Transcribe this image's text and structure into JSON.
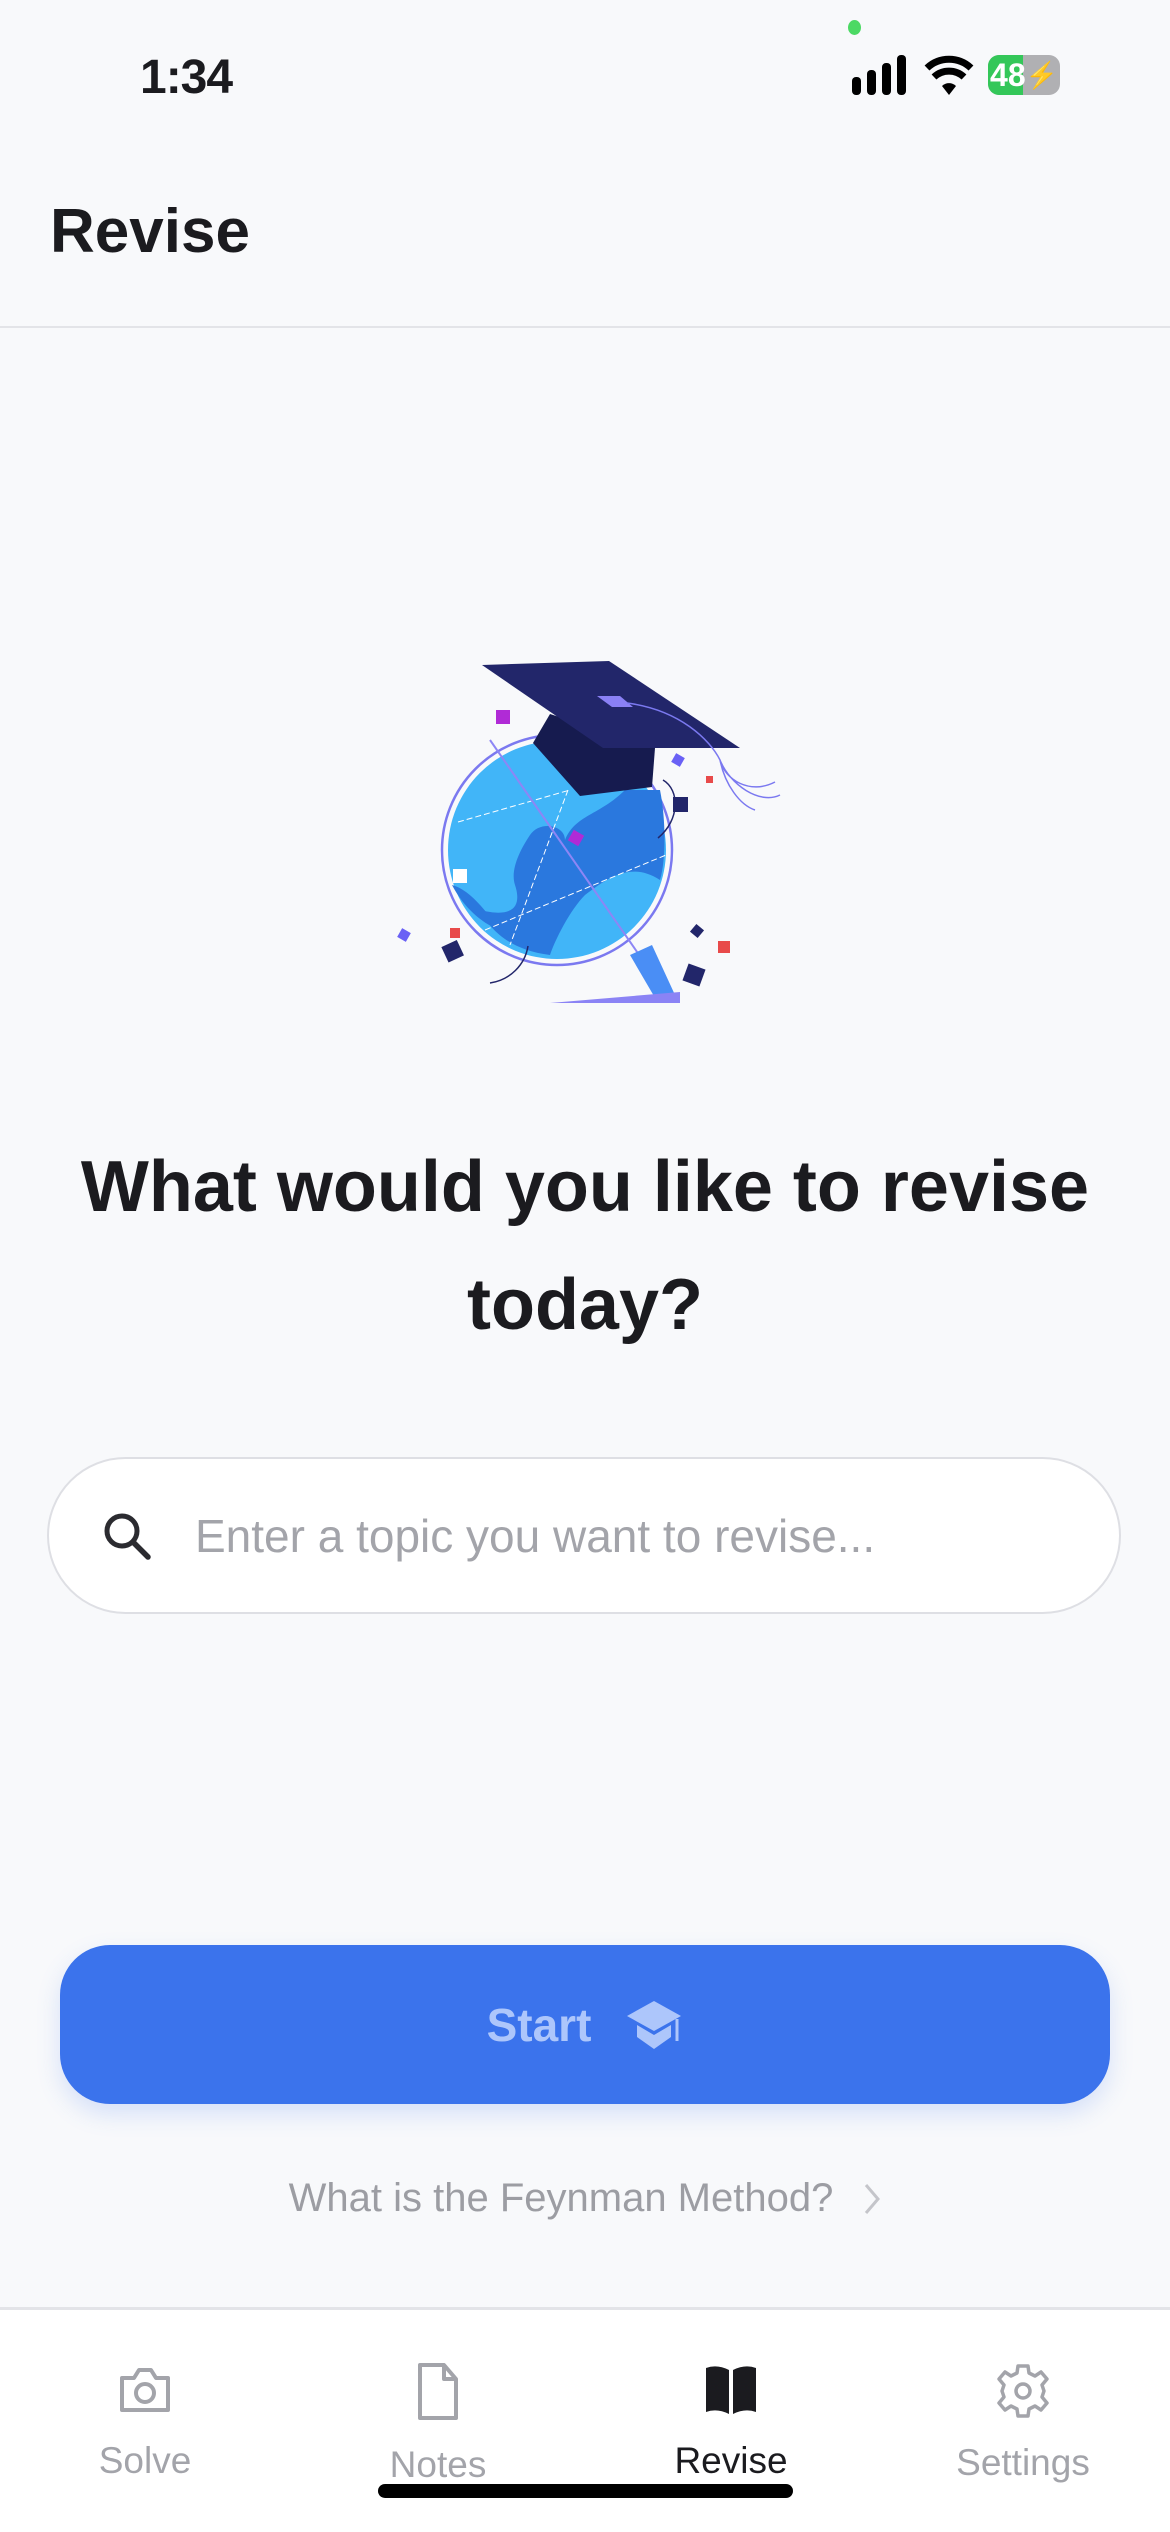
{
  "status_bar": {
    "time": "1:34",
    "battery": "48"
  },
  "header": {
    "title": "Revise"
  },
  "main": {
    "heading": "What would you like to revise today?",
    "search": {
      "placeholder": "Enter a topic you want to revise...",
      "value": "",
      "icon": "search-icon"
    },
    "start_button": {
      "label": "Start",
      "icon": "graduation-cap-icon"
    },
    "feynman_link": {
      "label": "What is the Feynman Method?",
      "icon": "chevron-right-icon"
    }
  },
  "tabbar": {
    "items": [
      {
        "label": "Solve",
        "icon": "camera-icon",
        "active": false
      },
      {
        "label": "Notes",
        "icon": "document-icon",
        "active": false
      },
      {
        "label": "Revise",
        "icon": "book-icon",
        "active": true
      },
      {
        "label": "Settings",
        "icon": "gear-icon",
        "active": false
      }
    ]
  },
  "colors": {
    "accent": "#3b73ec",
    "background": "#f8f9fb",
    "active_tab": "#1b1b1f",
    "inactive_tab": "#a3a4aa"
  }
}
